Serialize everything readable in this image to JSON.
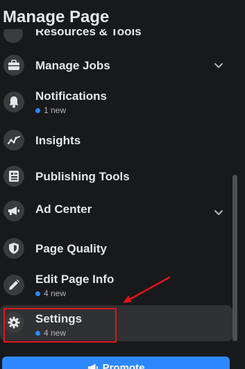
{
  "header": {
    "title": "Manage Page"
  },
  "partial_item": {
    "label": "Resources & Tools"
  },
  "menu": {
    "manage_jobs": {
      "label": "Manage Jobs"
    },
    "notifications": {
      "label": "Notifications",
      "sub": "1 new"
    },
    "insights": {
      "label": "Insights"
    },
    "publishing_tools": {
      "label": "Publishing Tools"
    },
    "ad_center": {
      "label": "Ad Center"
    },
    "page_quality": {
      "label": "Page Quality"
    },
    "edit_page_info": {
      "label": "Edit Page Info",
      "sub": "4 new"
    },
    "settings": {
      "label": "Settings",
      "sub": "4 new"
    }
  },
  "footer": {
    "promote_label": "Promote"
  },
  "colors": {
    "background": "#18191a",
    "accent": "#2d88ff",
    "annotation": "#e0141d",
    "active_row": "#303132"
  },
  "icons": [
    "toolbox-icon",
    "bell-icon",
    "insights-icon",
    "publishing-tools-icon",
    "megaphone-icon",
    "shield-icon",
    "pencil-icon",
    "gear-icon",
    "chevron-down-icon"
  ]
}
